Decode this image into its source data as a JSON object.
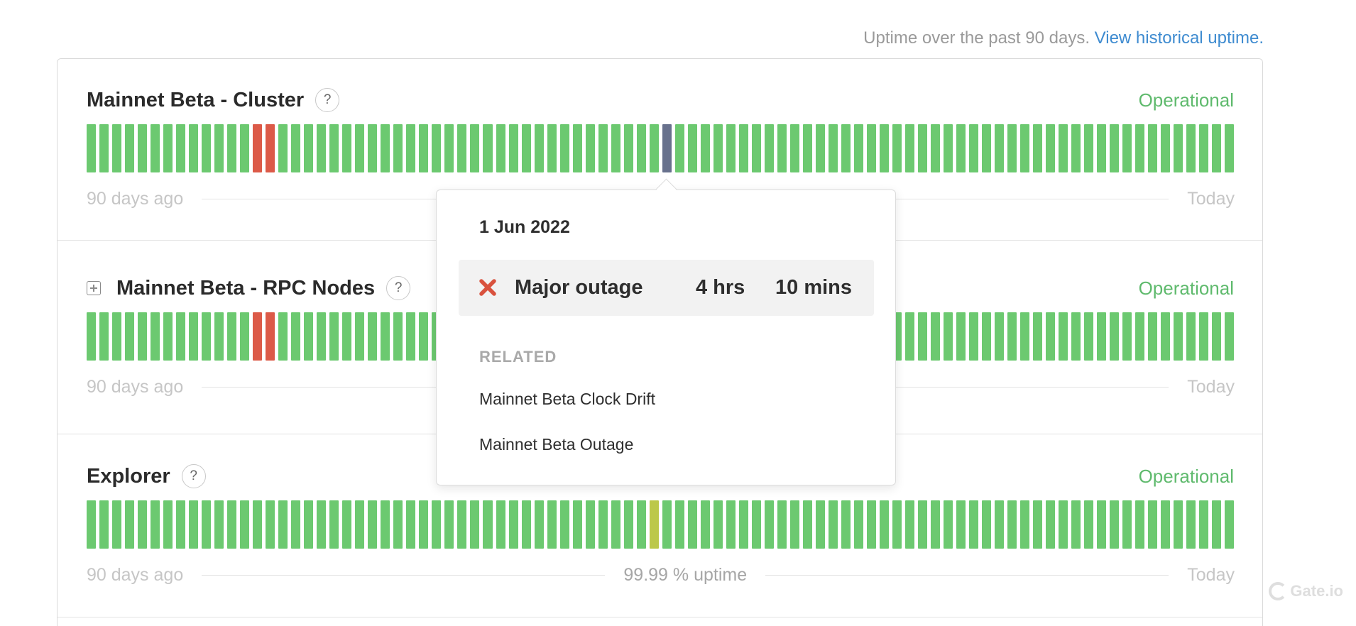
{
  "header": {
    "note": "Uptime over the past 90 days.",
    "link_label": "View historical uptime."
  },
  "colors": {
    "operational": "#6cc970",
    "major_outage": "#dc5a48",
    "degraded": "#bcc84a",
    "selected_day": "#68718d",
    "status_text": "#5fba6d",
    "link": "#3e8bd0"
  },
  "sections": [
    {
      "title": "Mainnet Beta - Cluster",
      "status": "Operational",
      "expandable": false,
      "start_label": "90 days ago",
      "end_label": "Today",
      "uptime_label": "",
      "days": 90,
      "major_days": [
        13,
        14
      ],
      "degraded_days": [],
      "selected_day": 45
    },
    {
      "title": "Mainnet Beta - RPC Nodes",
      "status": "Operational",
      "expandable": true,
      "start_label": "90 days ago",
      "end_label": "Today",
      "uptime_label": "",
      "days": 90,
      "major_days": [
        13,
        14
      ],
      "degraded_days": [],
      "selected_day": null
    },
    {
      "title": "Explorer",
      "status": "Operational",
      "expandable": false,
      "start_label": "90 days ago",
      "end_label": "Today",
      "uptime_label": "99.99 % uptime",
      "days": 90,
      "major_days": [],
      "degraded_days": [
        44
      ],
      "selected_day": null
    }
  ],
  "tooltip": {
    "date": "1 Jun 2022",
    "incident_icon": "x-icon",
    "incident_type": "Major outage",
    "duration_hours": "4 hrs",
    "duration_minutes": "10 mins",
    "related_heading": "RELATED",
    "related": [
      "Mainnet Beta Clock Drift",
      "Mainnet Beta Outage"
    ]
  },
  "watermark": "Gate.io"
}
